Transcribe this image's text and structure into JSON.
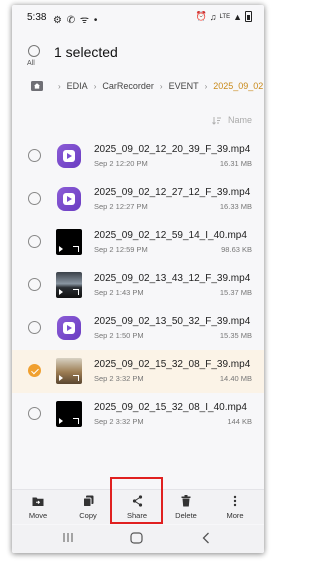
{
  "status_bar": {
    "time": "5:38",
    "left_icons": [
      "gear-icon",
      "missed-call-icon",
      "wifi-call-icon",
      "notification-icon"
    ],
    "right_icons": [
      "alarm-icon",
      "mute-icon",
      "volte-icon",
      "signal-icon",
      "battery-icon"
    ]
  },
  "selection": {
    "title": "1 selected",
    "all_label": "All"
  },
  "path": {
    "segments": [
      "EDIA",
      "CarRecorder",
      "EVENT",
      "2025_09_02"
    ]
  },
  "sort": {
    "label": "Name"
  },
  "files": [
    {
      "name": "2025_09_02_12_20_39_F_39.mp4",
      "date": "Sep 2 12:20 PM",
      "size": "16.31 MB",
      "thumb": "purple-video-icon",
      "selected": false
    },
    {
      "name": "2025_09_02_12_27_12_F_39.mp4",
      "date": "Sep 2 12:27 PM",
      "size": "16.33 MB",
      "thumb": "purple-video-icon",
      "selected": false
    },
    {
      "name": "2025_09_02_12_59_14_I_40.mp4",
      "date": "Sep 2 12:59 PM",
      "size": "98.63 KB",
      "thumb": "black-video-thumbnail",
      "selected": false
    },
    {
      "name": "2025_09_02_13_43_12_F_39.mp4",
      "date": "Sep 2 1:43 PM",
      "size": "15.37 MB",
      "thumb": "street-video-thumbnail",
      "selected": false
    },
    {
      "name": "2025_09_02_13_50_32_F_39.mp4",
      "date": "Sep 2 1:50 PM",
      "size": "15.35 MB",
      "thumb": "purple-video-icon",
      "selected": false
    },
    {
      "name": "2025_09_02_15_32_08_F_39.mp4",
      "date": "Sep 2 3:32 PM",
      "size": "14.40 MB",
      "thumb": "car-video-thumbnail",
      "selected": true
    },
    {
      "name": "2025_09_02_15_32_08_I_40.mp4",
      "date": "Sep 2 3:32 PM",
      "size": "144 KB",
      "thumb": "black-video-thumbnail",
      "selected": false
    }
  ],
  "toolbar": {
    "move_label": "Move",
    "copy_label": "Copy",
    "share_label": "Share",
    "delete_label": "Delete",
    "more_label": "More"
  },
  "colors": {
    "accent": "#f0a030",
    "path_current": "#c98a1a",
    "selected_row": "#fbf3e7",
    "highlight_box": "#e02020"
  }
}
